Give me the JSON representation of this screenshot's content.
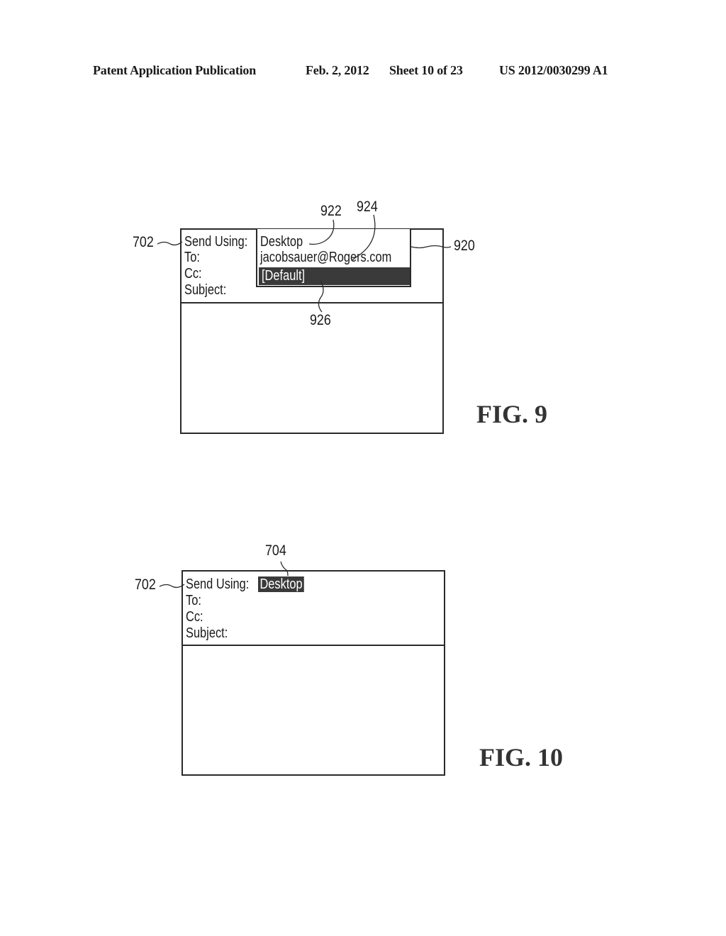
{
  "header": {
    "publication": "Patent Application Publication",
    "date": "Feb. 2, 2012",
    "sheet": "Sheet 10 of 23",
    "number": "US 2012/0030299 A1"
  },
  "fig9": {
    "caption": "FIG. 9",
    "fields": [
      "Send Using:",
      "To:",
      "Cc:",
      "Subject:"
    ],
    "dropdown": {
      "options": [
        "Desktop",
        "jacobsauer@Rogers.com",
        "[Default]"
      ],
      "selected_index": 2
    },
    "refs": {
      "screen": "702",
      "dropdown": "920",
      "option_desktop": "922",
      "option_email": "924",
      "option_default": "926"
    }
  },
  "fig10": {
    "caption": "FIG. 10",
    "fields": [
      "Send Using:",
      "To:",
      "Cc:",
      "Subject:"
    ],
    "send_using_value": "Desktop",
    "refs": {
      "screen": "702",
      "send_using_value": "704"
    }
  },
  "colors": {
    "ink": "#2a2a2a",
    "highlight": "#3a3a3a"
  }
}
